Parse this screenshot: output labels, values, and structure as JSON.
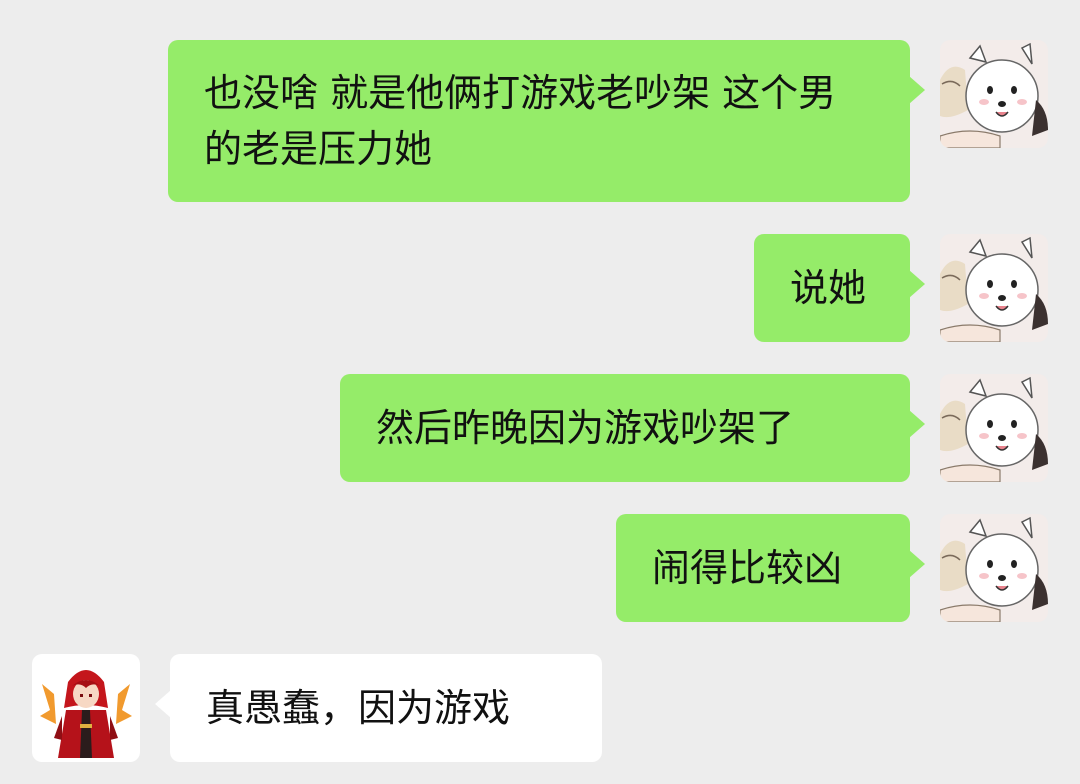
{
  "conversation": {
    "messages": [
      {
        "sender": "me",
        "text": "也没啥  就是他俩打游戏老吵架  这个男的老是压力她",
        "avatar": "white-dog-hug-avatar"
      },
      {
        "sender": "me",
        "text": "说她",
        "avatar": "white-dog-hug-avatar"
      },
      {
        "sender": "me",
        "text": "然后昨晚因为游戏吵架了",
        "avatar": "white-dog-hug-avatar"
      },
      {
        "sender": "me",
        "text": "闹得比较凶",
        "avatar": "white-dog-hug-avatar"
      },
      {
        "sender": "other",
        "text": "真愚蠢，因为游戏",
        "avatar": "red-hair-character-avatar"
      }
    ]
  },
  "colors": {
    "background": "#ededed",
    "outgoing_bubble": "#95ec69",
    "incoming_bubble": "#ffffff",
    "text": "#111111"
  }
}
